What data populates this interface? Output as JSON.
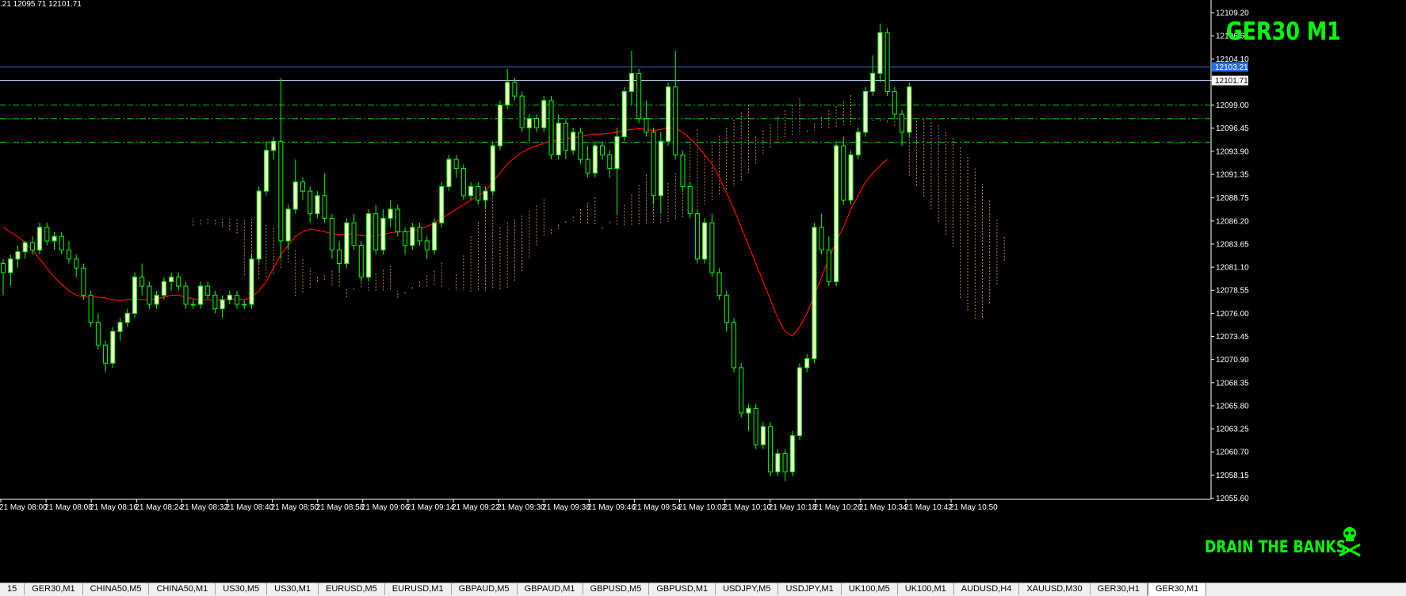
{
  "header": {
    "ohlc_text": ".21 12095.71 12101.71"
  },
  "title": "GER30 M1",
  "footer_text": "DRAIN THE BANKS",
  "colors": {
    "bull": "#00ff00",
    "bull_body": "#ffffcc",
    "ma": "#ff0000",
    "blue_line": "#1e6fe0",
    "dashed": "#00cc00",
    "cloud": "#f4a460",
    "axis": "#ffffff"
  },
  "price_labels": [
    "12109.20",
    "12106.65",
    "12104.10",
    "12101.71",
    "12099.00",
    "12096.45",
    "12093.90",
    "12091.35",
    "12088.75",
    "12086.20",
    "12083.65",
    "12081.10",
    "12078.55",
    "12076.00",
    "12073.45",
    "12070.90",
    "12068.35",
    "12065.80",
    "12063.25",
    "12060.70",
    "12058.15",
    "12055.60"
  ],
  "price_label_values": [
    12109.2,
    12106.65,
    12104.1,
    12101.71,
    12099.0,
    12096.45,
    12093.9,
    12091.35,
    12088.75,
    12086.2,
    12083.65,
    12081.1,
    12078.55,
    12076.0,
    12073.45,
    12070.9,
    12068.35,
    12065.8,
    12063.25,
    12060.7,
    12058.15,
    12055.6
  ],
  "highlight_price": "12103.21",
  "current_price": "12101.71",
  "time_labels": [
    "21 May 08:00",
    "21 May 08:08",
    "21 May 08:16",
    "21 May 08:24",
    "21 May 08:32",
    "21 May 08:40",
    "21 May 08:50",
    "21 May 08:58",
    "21 May 09:06",
    "21 May 09:14",
    "21 May 09:22",
    "21 May 09:30",
    "21 May 09:38",
    "21 May 09:46",
    "21 May 09:54",
    "21 May 10:02",
    "21 May 10:10",
    "21 May 10:18",
    "21 May 10:26",
    "21 May 10:34",
    "21 May 10:42",
    "21 May 10:50"
  ],
  "tabs": [
    "15",
    "GER30,M1",
    "CHINA50,M5",
    "CHINA50,M1",
    "US30,M5",
    "US30,M1",
    "EURUSD,M5",
    "EURUSD,M1",
    "GBPAUD,M5",
    "GBPAUD,M1",
    "GBPUSD,M5",
    "GBPUSD,M1",
    "USDJPY,M5",
    "USDJPY,M1",
    "UK100,M5",
    "UK100,M1",
    "AUDUSD,H4",
    "XAUUSD,M30",
    "GER30,H1",
    "GER30,M1"
  ],
  "active_tab": 19,
  "chart_data": {
    "type": "candlestick",
    "ylim": [
      12055.0,
      12110.6
    ],
    "horizontal_levels": {
      "solid": [
        12103.21,
        12101.71
      ],
      "dashed": [
        12099.0,
        12097.5,
        12094.9
      ]
    },
    "candles": [
      [
        12081.5,
        12082.0,
        12078.0,
        12080.5
      ],
      [
        12080.5,
        12082.5,
        12079.0,
        12082.0
      ],
      [
        12082.0,
        12083.5,
        12081.0,
        12082.8
      ],
      [
        12082.8,
        12084.0,
        12082.0,
        12083.8
      ],
      [
        12083.8,
        12084.5,
        12082.5,
        12083.0
      ],
      [
        12083.0,
        12086.0,
        12082.5,
        12085.5
      ],
      [
        12085.5,
        12086.0,
        12083.5,
        12084.0
      ],
      [
        12084.0,
        12085.0,
        12083.0,
        12084.5
      ],
      [
        12084.5,
        12085.0,
        12082.5,
        12083.0
      ],
      [
        12083.0,
        12084.0,
        12081.5,
        12082.0
      ],
      [
        12082.0,
        12082.5,
        12080.0,
        12081.0
      ],
      [
        12081.0,
        12081.5,
        12077.5,
        12078.0
      ],
      [
        12078.0,
        12078.5,
        12074.5,
        12075.0
      ],
      [
        12075.0,
        12076.0,
        12072.0,
        12072.5
      ],
      [
        12072.5,
        12073.0,
        12069.5,
        12070.5
      ],
      [
        12070.5,
        12074.5,
        12070.0,
        12074.0
      ],
      [
        12074.0,
        12075.5,
        12073.0,
        12075.0
      ],
      [
        12075.0,
        12076.5,
        12074.5,
        12076.0
      ],
      [
        12076.0,
        12080.5,
        12075.5,
        12080.0
      ],
      [
        12080.0,
        12081.5,
        12078.0,
        12079.0
      ],
      [
        12079.0,
        12079.5,
        12076.5,
        12077.0
      ],
      [
        12077.0,
        12078.5,
        12076.5,
        12078.0
      ],
      [
        12078.0,
        12080.0,
        12077.5,
        12079.5
      ],
      [
        12079.5,
        12080.5,
        12078.5,
        12080.0
      ],
      [
        12080.0,
        12080.5,
        12078.5,
        12079.0
      ],
      [
        12079.0,
        12079.5,
        12076.5,
        12077.0
      ],
      [
        12077.0,
        12077.5,
        12076.5,
        12077.0
      ],
      [
        12077.0,
        12079.5,
        12076.5,
        12079.0
      ],
      [
        12079.0,
        12079.5,
        12077.5,
        12078.0
      ],
      [
        12078.0,
        12078.5,
        12076.0,
        12076.5
      ],
      [
        12076.5,
        12078.0,
        12075.5,
        12077.5
      ],
      [
        12077.5,
        12078.5,
        12077.0,
        12078.0
      ],
      [
        12078.0,
        12078.5,
        12076.5,
        12077.0
      ],
      [
        12077.0,
        12077.5,
        12076.5,
        12077.0
      ],
      [
        12077.0,
        12082.5,
        12076.5,
        12082.0
      ],
      [
        12082.0,
        12090.0,
        12081.5,
        12089.5
      ],
      [
        12089.5,
        12095.0,
        12089.0,
        12094.0
      ],
      [
        12094.0,
        12095.5,
        12093.0,
        12095.0
      ],
      [
        12095.0,
        12102.0,
        12082.0,
        12084.0
      ],
      [
        12084.0,
        12088.0,
        12083.0,
        12087.5
      ],
      [
        12087.5,
        12093.0,
        12087.0,
        12090.5
      ],
      [
        12090.5,
        12091.0,
        12088.5,
        12089.5
      ],
      [
        12089.5,
        12090.0,
        12086.0,
        12087.0
      ],
      [
        12087.0,
        12089.5,
        12086.5,
        12089.0
      ],
      [
        12089.0,
        12091.5,
        12086.0,
        12086.5
      ],
      [
        12086.5,
        12087.0,
        12082.0,
        12083.0
      ],
      [
        12083.0,
        12084.0,
        12080.5,
        12081.5
      ],
      [
        12081.5,
        12086.5,
        12081.0,
        12086.0
      ],
      [
        12086.0,
        12087.0,
        12083.0,
        12083.5
      ],
      [
        12083.5,
        12084.0,
        12079.5,
        12080.0
      ],
      [
        12080.0,
        12087.5,
        12079.5,
        12087.0
      ],
      [
        12087.0,
        12088.0,
        12082.5,
        12083.0
      ],
      [
        12083.0,
        12087.5,
        12082.5,
        12086.5
      ],
      [
        12086.5,
        12088.5,
        12085.5,
        12087.5
      ],
      [
        12087.5,
        12088.0,
        12084.5,
        12085.0
      ],
      [
        12085.0,
        12085.5,
        12082.5,
        12083.5
      ],
      [
        12083.5,
        12086.0,
        12083.0,
        12085.5
      ],
      [
        12085.5,
        12086.0,
        12083.5,
        12084.0
      ],
      [
        12084.0,
        12084.5,
        12082.0,
        12083.0
      ],
      [
        12083.0,
        12086.5,
        12082.5,
        12086.0
      ],
      [
        12086.0,
        12090.5,
        12085.5,
        12090.0
      ],
      [
        12090.0,
        12093.5,
        12089.5,
        12093.0
      ],
      [
        12093.0,
        12093.5,
        12091.0,
        12092.0
      ],
      [
        12092.0,
        12092.5,
        12088.5,
        12089.0
      ],
      [
        12089.0,
        12090.5,
        12088.5,
        12090.0
      ],
      [
        12090.0,
        12090.5,
        12088.0,
        12088.5
      ],
      [
        12088.5,
        12090.0,
        12087.5,
        12089.5
      ],
      [
        12089.5,
        12095.0,
        12089.0,
        12094.5
      ],
      [
        12094.5,
        12099.5,
        12094.0,
        12099.0
      ],
      [
        12099.0,
        12103.0,
        12098.5,
        12101.5
      ],
      [
        12101.5,
        12102.0,
        12099.5,
        12100.0
      ],
      [
        12100.0,
        12100.5,
        12096.0,
        12096.5
      ],
      [
        12096.5,
        12098.0,
        12095.0,
        12097.5
      ],
      [
        12097.5,
        12098.0,
        12096.0,
        12096.5
      ],
      [
        12096.5,
        12100.0,
        12096.0,
        12099.5
      ],
      [
        12099.5,
        12100.0,
        12093.0,
        12093.5
      ],
      [
        12093.5,
        12098.0,
        12093.0,
        12097.0
      ],
      [
        12097.0,
        12097.5,
        12093.0,
        12094.0
      ],
      [
        12094.0,
        12096.5,
        12093.5,
        12096.0
      ],
      [
        12096.0,
        12096.5,
        12092.5,
        12093.0
      ],
      [
        12093.0,
        12094.5,
        12091.0,
        12091.5
      ],
      [
        12091.5,
        12095.0,
        12091.0,
        12094.5
      ],
      [
        12094.5,
        12095.0,
        12093.0,
        12093.5
      ],
      [
        12093.5,
        12094.0,
        12091.0,
        12092.0
      ],
      [
        12092.0,
        12096.5,
        12087.0,
        12095.5
      ],
      [
        12095.5,
        12101.0,
        12095.0,
        12100.5
      ],
      [
        12100.5,
        12105.0,
        12099.0,
        12102.5
      ],
      [
        12102.5,
        12103.0,
        12097.0,
        12097.5
      ],
      [
        12097.5,
        12099.5,
        12095.5,
        12096.0
      ],
      [
        12096.0,
        12096.5,
        12088.0,
        12089.0
      ],
      [
        12089.0,
        12096.0,
        12087.0,
        12095.0
      ],
      [
        12095.0,
        12101.5,
        12094.5,
        12101.0
      ],
      [
        12101.0,
        12105.0,
        12093.0,
        12093.5
      ],
      [
        12093.5,
        12094.0,
        12089.5,
        12090.0
      ],
      [
        12090.0,
        12090.5,
        12086.5,
        12087.0
      ],
      [
        12087.0,
        12087.5,
        12081.5,
        12082.0
      ],
      [
        12082.0,
        12086.5,
        12081.5,
        12086.0
      ],
      [
        12086.0,
        12087.0,
        12080.0,
        12080.5
      ],
      [
        12080.5,
        12081.0,
        12077.5,
        12078.0
      ],
      [
        12078.0,
        12078.5,
        12074.0,
        12075.0
      ],
      [
        12075.0,
        12075.5,
        12069.5,
        12070.0
      ],
      [
        12070.0,
        12070.5,
        12064.5,
        12065.0
      ],
      [
        12065.0,
        12066.0,
        12063.0,
        12065.5
      ],
      [
        12065.5,
        12066.0,
        12061.0,
        12061.5
      ],
      [
        12061.5,
        12064.0,
        12061.0,
        12063.5
      ],
      [
        12063.5,
        12064.0,
        12058.0,
        12058.5
      ],
      [
        12058.5,
        12061.0,
        12058.0,
        12060.5
      ],
      [
        12060.5,
        12061.0,
        12057.5,
        12058.5
      ],
      [
        12058.5,
        12063.0,
        12058.0,
        12062.5
      ],
      [
        12062.5,
        12070.5,
        12062.0,
        12070.0
      ],
      [
        12070.0,
        12071.5,
        12069.5,
        12071.0
      ],
      [
        12071.0,
        12086.0,
        12070.5,
        12085.5
      ],
      [
        12085.5,
        12087.0,
        12082.5,
        12083.0
      ],
      [
        12083.0,
        12084.5,
        12079.0,
        12079.5
      ],
      [
        12079.5,
        12095.0,
        12079.0,
        12094.5
      ],
      [
        12094.5,
        12095.5,
        12088.0,
        12088.5
      ],
      [
        12088.5,
        12094.0,
        12088.0,
        12093.5
      ],
      [
        12093.5,
        12096.5,
        12093.0,
        12096.0
      ],
      [
        12096.0,
        12101.0,
        12095.5,
        12100.5
      ],
      [
        12100.5,
        12104.5,
        12100.0,
        12102.5
      ],
      [
        12102.5,
        12108.0,
        12101.5,
        12107.0
      ],
      [
        12107.0,
        12107.5,
        12100.0,
        12100.5
      ],
      [
        12100.5,
        12101.0,
        12097.5,
        12098.0
      ],
      [
        12098.0,
        12098.5,
        12094.5,
        12096.0
      ],
      [
        12096.0,
        12101.5,
        12095.5,
        12101.0
      ]
    ],
    "ma_line": [
      12085.5,
      12085.0,
      12084.5,
      12083.8,
      12083.0,
      12082.0,
      12081.0,
      12080.0,
      12079.2,
      12078.5,
      12078.0,
      12077.8,
      12077.8,
      12077.8,
      12077.7,
      12077.5,
      12077.4,
      12077.5,
      12077.6,
      12077.5,
      12077.5,
      12077.6,
      12077.8,
      12078.0,
      12078.0,
      12077.8,
      12077.6,
      12077.5,
      12077.5,
      12077.4,
      12077.5,
      12077.5,
      12077.6,
      12077.5,
      12077.8,
      12078.5,
      12079.5,
      12081.0,
      12082.5,
      12083.5,
      12084.5,
      12085.0,
      12085.3,
      12085.2,
      12085.0,
      12084.8,
      12084.7,
      12084.7,
      12084.8,
      12084.6,
      12084.5,
      12084.6,
      12084.7,
      12084.9,
      12085.0,
      12085.0,
      12085.1,
      12085.3,
      12085.6,
      12086.0,
      12086.5,
      12087.0,
      12087.5,
      12088.0,
      12088.5,
      12089.0,
      12089.5,
      12090.5,
      12091.5,
      12092.5,
      12093.2,
      12093.8,
      12094.2,
      12094.5,
      12094.8,
      12095.0,
      12095.2,
      12095.3,
      12095.4,
      12095.5,
      12095.7,
      12095.8,
      12095.8,
      12095.9,
      12096.0,
      12096.2,
      12096.3,
      12096.4,
      12096.3,
      12096.2,
      12096.3,
      12096.5,
      12096.4,
      12096.0,
      12095.3,
      12094.5,
      12093.5,
      12092.5,
      12091.0,
      12089.3,
      12087.5,
      12085.5,
      12083.5,
      12081.5,
      12079.5,
      12077.5,
      12075.5,
      12074.0,
      12073.5,
      12074.5,
      12076.0,
      12078.0,
      12080.0,
      12082.0,
      12084.0,
      12085.5,
      12087.5,
      12089.0,
      12090.5,
      12091.5,
      12092.3,
      12093.0
    ]
  }
}
